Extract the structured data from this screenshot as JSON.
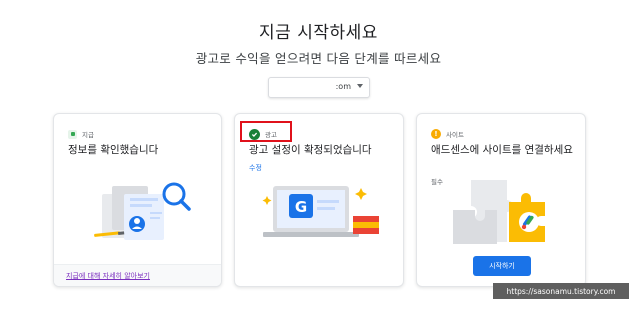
{
  "header": {
    "title": "지금 시작하세요",
    "subtitle": "광고로 수익을 얻으려면 다음 단계를 따르세요"
  },
  "site_selector": {
    "value": ":om"
  },
  "cards": [
    {
      "step_label": "지급",
      "title": "정보를 확인했습니다",
      "footer_link": "지급에 대해 자세히 알아보기",
      "status_icon": "payment-step-icon"
    },
    {
      "step_label": "광고",
      "title": "광고 설정이 확정되었습니다",
      "edit_link": "수정",
      "status_icon": "check-circle-icon"
    },
    {
      "step_label": "사이트",
      "title": "애드센스에 사이트를 연결하세요",
      "required": "필수",
      "button": "시작하기",
      "status_icon": "warning-icon"
    }
  ],
  "watermark": "https://sasonamu.tistory.com",
  "colors": {
    "accent_blue": "#1a73e8",
    "success_green": "#188038",
    "warning_yellow": "#f9ab00",
    "highlight_red": "#e0111b"
  }
}
